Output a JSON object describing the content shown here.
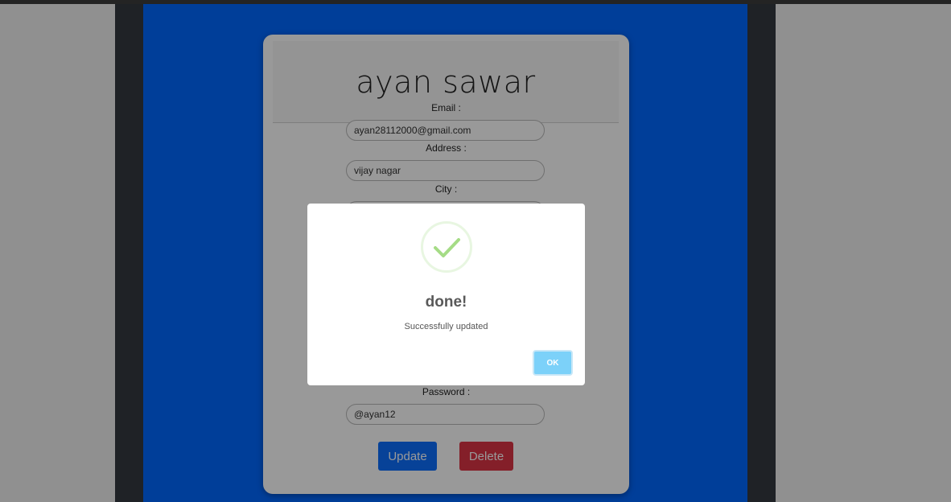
{
  "profile": {
    "name": "ayan sawar",
    "fields": {
      "email": {
        "label": "Email :",
        "value": "ayan28112000@gmail.com"
      },
      "address": {
        "label": "Address :",
        "value": "vijay nagar"
      },
      "city": {
        "label": "City :",
        "value": ""
      },
      "password": {
        "label": "Password :",
        "value": "@ayan12"
      }
    },
    "buttons": {
      "update": "Update",
      "delete": "Delete"
    }
  },
  "dialog": {
    "icon": "checkmark-icon",
    "title": "done!",
    "message": "Successfully updated",
    "ok_label": "OK"
  },
  "colors": {
    "background_blue": "#0068ff",
    "frame_dark": "#343a40",
    "update_button": "#0d6efd",
    "delete_button": "#dc3545",
    "ok_button": "#7cd1f9",
    "check_green": "#a5dc86"
  }
}
